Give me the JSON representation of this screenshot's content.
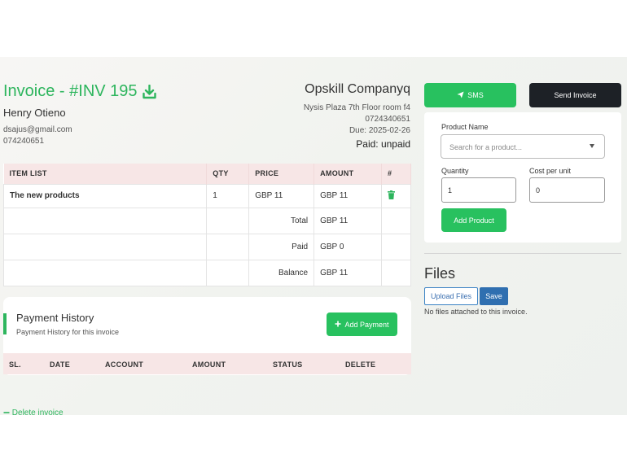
{
  "invoice": {
    "title": "Invoice - #INV 195",
    "customer_name": "Henry Otieno",
    "customer_email": "dsajus@gmail.com",
    "customer_phone": "074240651"
  },
  "company": {
    "name": "Opskill Companyq",
    "address": "Nysis Plaza 7th Floor room f4",
    "phone": "0724340651",
    "due": "Due: 2025-02-26",
    "paid_status": "Paid: unpaid"
  },
  "items_table": {
    "headers": [
      "ITEM LIST",
      "QTY",
      "PRICE",
      "AMOUNT",
      "#"
    ],
    "rows": [
      {
        "item": "The new products",
        "qty": "1",
        "price": "GBP 11",
        "amount": "GBP 11"
      }
    ],
    "summary": [
      {
        "label": "Total",
        "value": "GBP 11"
      },
      {
        "label": "Paid",
        "value": "GBP 0"
      },
      {
        "label": "Balance",
        "value": "GBP 11"
      }
    ]
  },
  "payment_history": {
    "title": "Payment History",
    "subtitle": "Payment History for this invoice",
    "add_button": "Add Payment",
    "headers": [
      "SL.",
      "DATE",
      "ACCOUNT",
      "AMOUNT",
      "STATUS",
      "DELETE"
    ]
  },
  "delete_invoice_label": "Delete invoice",
  "actions": {
    "sms_label": "SMS",
    "send_invoice_label": "Send Invoice"
  },
  "product_form": {
    "product_name_label": "Product Name",
    "product_placeholder": "Search for a product...",
    "quantity_label": "Quantity",
    "quantity_value": "1",
    "cost_label": "Cost per unit",
    "cost_value": "0",
    "add_button": "Add Product"
  },
  "files": {
    "title": "Files",
    "upload_label": "Upload Files",
    "save_label": "Save",
    "empty_message": "No files attached to this invoice."
  },
  "colors": {
    "accent_green": "#28c15f",
    "header_pink": "#f7e6e6",
    "dark_button": "#1d2126",
    "blue": "#2f6fb0"
  },
  "icons": [
    "download-icon",
    "paper-plane-icon",
    "trash-icon",
    "plus-icon",
    "minus-icon",
    "chevron-down-icon"
  ]
}
